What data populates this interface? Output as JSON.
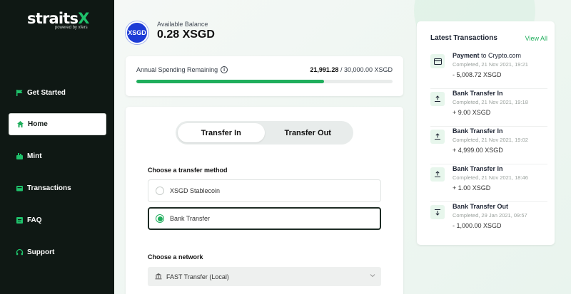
{
  "brand": {
    "name_main": "straits",
    "name_x": "X",
    "tagline": "powered by xfers",
    "accent": "#1fae5c"
  },
  "sidebar": {
    "items": [
      {
        "label": "Get Started",
        "icon": "flag-icon"
      },
      {
        "label": "Home",
        "icon": "home-icon",
        "active": true
      },
      {
        "label": "Mint",
        "icon": "mint-icon"
      },
      {
        "label": "Transactions",
        "icon": "wallet-icon"
      },
      {
        "label": "FAQ",
        "icon": "faq-icon"
      },
      {
        "label": "Support",
        "icon": "headset-icon"
      }
    ]
  },
  "balance": {
    "badge": "XSGD",
    "label": "Available Balance",
    "value": "0.28 XSGD"
  },
  "spending": {
    "label": "Annual Spending Remaining",
    "remaining": "21,991.28",
    "total": "/ 30,000.00 XSGD",
    "progress_fraction": 0.733
  },
  "transfer": {
    "tabs": [
      {
        "label": "Transfer In",
        "active": true
      },
      {
        "label": "Transfer Out",
        "active": false
      }
    ],
    "method_label": "Choose a transfer method",
    "methods": [
      {
        "label": "XSGD Stablecoin",
        "selected": false
      },
      {
        "label": "Bank Transfer",
        "selected": true
      }
    ],
    "network_label": "Choose a network",
    "network_value": "FAST Transfer (Local)"
  },
  "transactions": {
    "title": "Latest Transactions",
    "view_all": "View All",
    "items": [
      {
        "type": "Payment",
        "suffix": " to Crypto.com",
        "date": "Completed, 21 Nov 2021, 19:21",
        "amount": "- 5,008.72 XSGD",
        "icon": "card-icon"
      },
      {
        "type": "Bank Transfer In",
        "suffix": "",
        "date": "Completed, 21 Nov 2021, 19:18",
        "amount": "+ 9.00 XSGD",
        "icon": "arrow-up-icon"
      },
      {
        "type": "Bank Transfer In",
        "suffix": "",
        "date": "Completed, 21 Nov 2021, 19:02",
        "amount": "+ 4,999.00 XSGD",
        "icon": "arrow-up-icon"
      },
      {
        "type": "Bank Transfer In",
        "suffix": "",
        "date": "Completed, 21 Nov 2021, 18:46",
        "amount": "+ 1.00 XSGD",
        "icon": "arrow-up-icon"
      },
      {
        "type": "Bank Transfer Out",
        "suffix": "",
        "date": "Completed, 29 Jan 2021, 09:57",
        "amount": "- 1,000.00 XSGD",
        "icon": "arrow-down-icon"
      }
    ]
  }
}
